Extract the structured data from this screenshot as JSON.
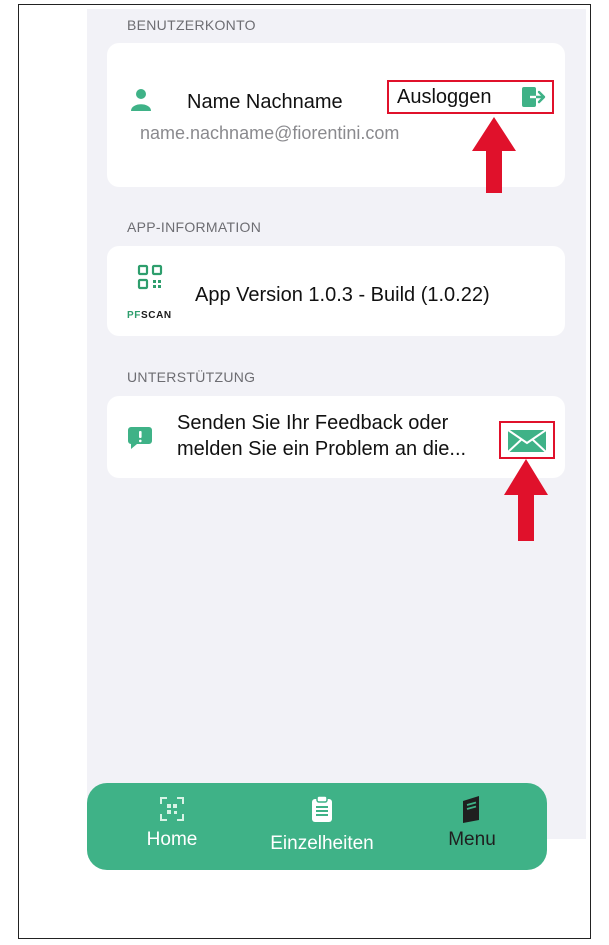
{
  "account": {
    "section_title": "BENUTZERKONTO",
    "name": "Name Nachname",
    "email": "name.nachname@fiorentini.com",
    "logout_label": "Ausloggen",
    "person_icon": "person-icon",
    "logout_icon": "logout-icon"
  },
  "app_info": {
    "section_title": "APP-INFORMATION",
    "logo_text_accent": "PF",
    "logo_text_rest": "SCAN",
    "version_text": "App Version 1.0.3 - Build (1.0.22)"
  },
  "support": {
    "section_title": "UNTERSTÜTZUNG",
    "feedback_line1": "Senden Sie Ihr Feedback oder",
    "feedback_line2": "melden Sie ein Problem an die...",
    "mail_icon": "mail-icon"
  },
  "tabbar": {
    "tabs": [
      {
        "label": "Home",
        "icon": "qr-scan-icon"
      },
      {
        "label": "Einzelheiten",
        "icon": "clipboard-icon"
      },
      {
        "label": "Menu",
        "icon": "book-icon"
      }
    ],
    "active": "Menu"
  },
  "colors": {
    "brand_green": "#3fb287",
    "highlight_red": "#e0112b",
    "background": "#f2f2f7"
  }
}
